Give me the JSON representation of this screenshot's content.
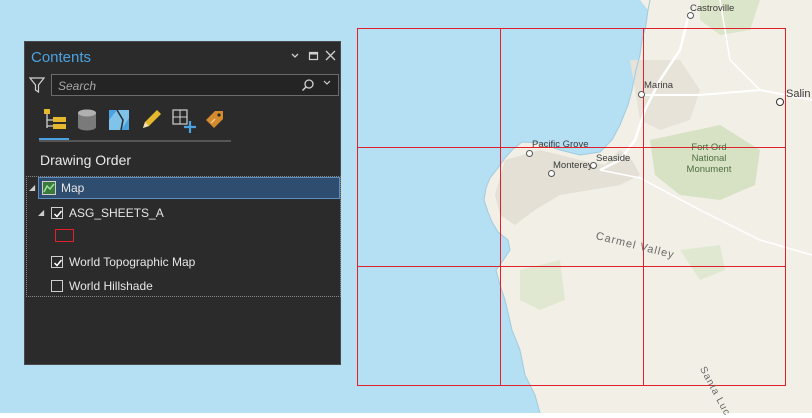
{
  "map": {
    "labels": {
      "castroville": "Castroville",
      "marina": "Marina",
      "salinas": "Salin",
      "pacific_grove": "Pacific Grove",
      "monterey": "Monterey",
      "seaside": "Seaside",
      "fort_ord": "Fort Ord National Monument",
      "carmel_valley": "Carmel Valley",
      "santa_lucia": "Santa Luc"
    },
    "grid_color": "#e0202a",
    "water_color": "#b5dff3",
    "land_color": "#f2efe6",
    "park_color": "#d6e2c3"
  },
  "contents": {
    "title": "Contents",
    "header_buttons": [
      "chevron-down-icon",
      "maximize-icon",
      "close-icon"
    ],
    "search": {
      "placeholder": "Search"
    },
    "toolbar": [
      {
        "name": "list-by-drawing-order-icon",
        "active": true
      },
      {
        "name": "list-by-data-source-icon"
      },
      {
        "name": "list-by-selection-icon"
      },
      {
        "name": "list-by-editing-icon"
      },
      {
        "name": "list-by-snapping-icon"
      },
      {
        "name": "list-by-labeling-icon"
      }
    ],
    "section_title": "Drawing Order",
    "tree": {
      "map": "Map",
      "layers": [
        {
          "label": "ASG_SHEETS_A",
          "checked": true,
          "expanded": true
        },
        {
          "label": "World Topographic Map",
          "checked": true
        },
        {
          "label": "World Hillshade",
          "checked": false
        }
      ]
    }
  }
}
